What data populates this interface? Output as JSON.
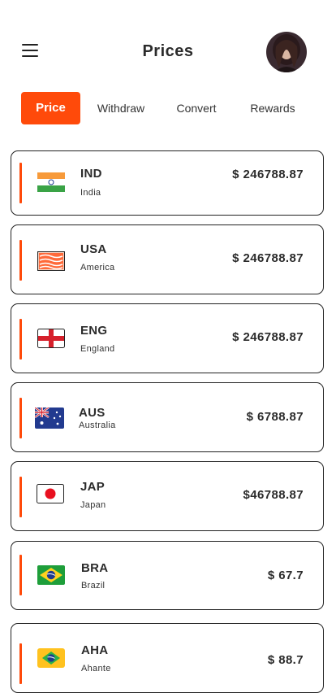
{
  "header": {
    "title": "Prices"
  },
  "tabs": [
    {
      "label": "Price",
      "active": true
    },
    {
      "label": "Withdraw",
      "active": false
    },
    {
      "label": "Convert",
      "active": false
    },
    {
      "label": "Rewards",
      "active": false
    }
  ],
  "accent_color": "#ff4a0a",
  "currencies": [
    {
      "code": "IND",
      "name": "India",
      "price": "$ 246788.87",
      "flag_icon": "india-flag-icon"
    },
    {
      "code": "USA",
      "name": "America",
      "price": "$ 246788.87",
      "flag_icon": "usa-flag-icon"
    },
    {
      "code": "ENG",
      "name": "England",
      "price": "$ 246788.87",
      "flag_icon": "england-flag-icon"
    },
    {
      "code": "AUS",
      "name": "Australia",
      "price": "$ 6788.87",
      "flag_icon": "australia-flag-icon"
    },
    {
      "code": "JAP",
      "name": "Japan",
      "price": "$46788.87",
      "flag_icon": "japan-flag-icon"
    },
    {
      "code": "BRA",
      "name": "Brazil",
      "price": "$ 67.7",
      "flag_icon": "brazil-flag-icon"
    },
    {
      "code": "AHA",
      "name": "Ahante",
      "price": "$ 88.7",
      "flag_icon": "brazil-flag-icon"
    }
  ]
}
